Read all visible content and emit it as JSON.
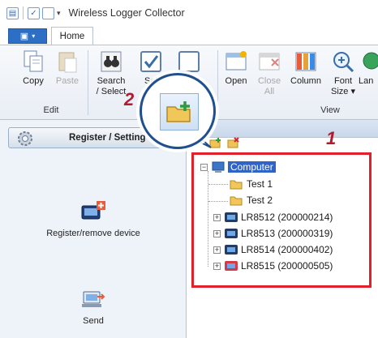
{
  "window": {
    "title": "Wireless Logger Collector"
  },
  "tabs": [
    {
      "label": "Home"
    }
  ],
  "ribbon": {
    "buttons": {
      "copy": "Copy",
      "paste": "Paste",
      "search_l1": "Search",
      "search_l2": "/ Select",
      "select_l1": "Sel",
      "select_extra": "ect",
      "open": "Open",
      "close_l1": "Close",
      "close_l2": "All",
      "column": "Column",
      "font_l1": "Font",
      "font_l2": "Size",
      "lang": "Lan"
    },
    "groups": {
      "edit": "Edit",
      "view": "View"
    }
  },
  "left_panel": {
    "register_bar_label": "Register / Setting",
    "items": [
      {
        "label": "Register/remove device",
        "icon": "register-device-icon"
      },
      {
        "label": "Send",
        "icon": "send-icon"
      }
    ]
  },
  "tree": {
    "root": "Computer",
    "folders": [
      "Test 1",
      "Test 2"
    ],
    "devices": [
      "LR8512 (200000214)",
      "LR8513 (200000319)",
      "LR8514 (200000402)",
      "LR8515 (200000505)"
    ]
  },
  "callouts": {
    "one": "1",
    "two": "2"
  },
  "colors": {
    "accent": "#2c6fc4",
    "highlight_box": "#e0202a",
    "callout_number": "#b21a30",
    "selection": "#2f63c8"
  }
}
